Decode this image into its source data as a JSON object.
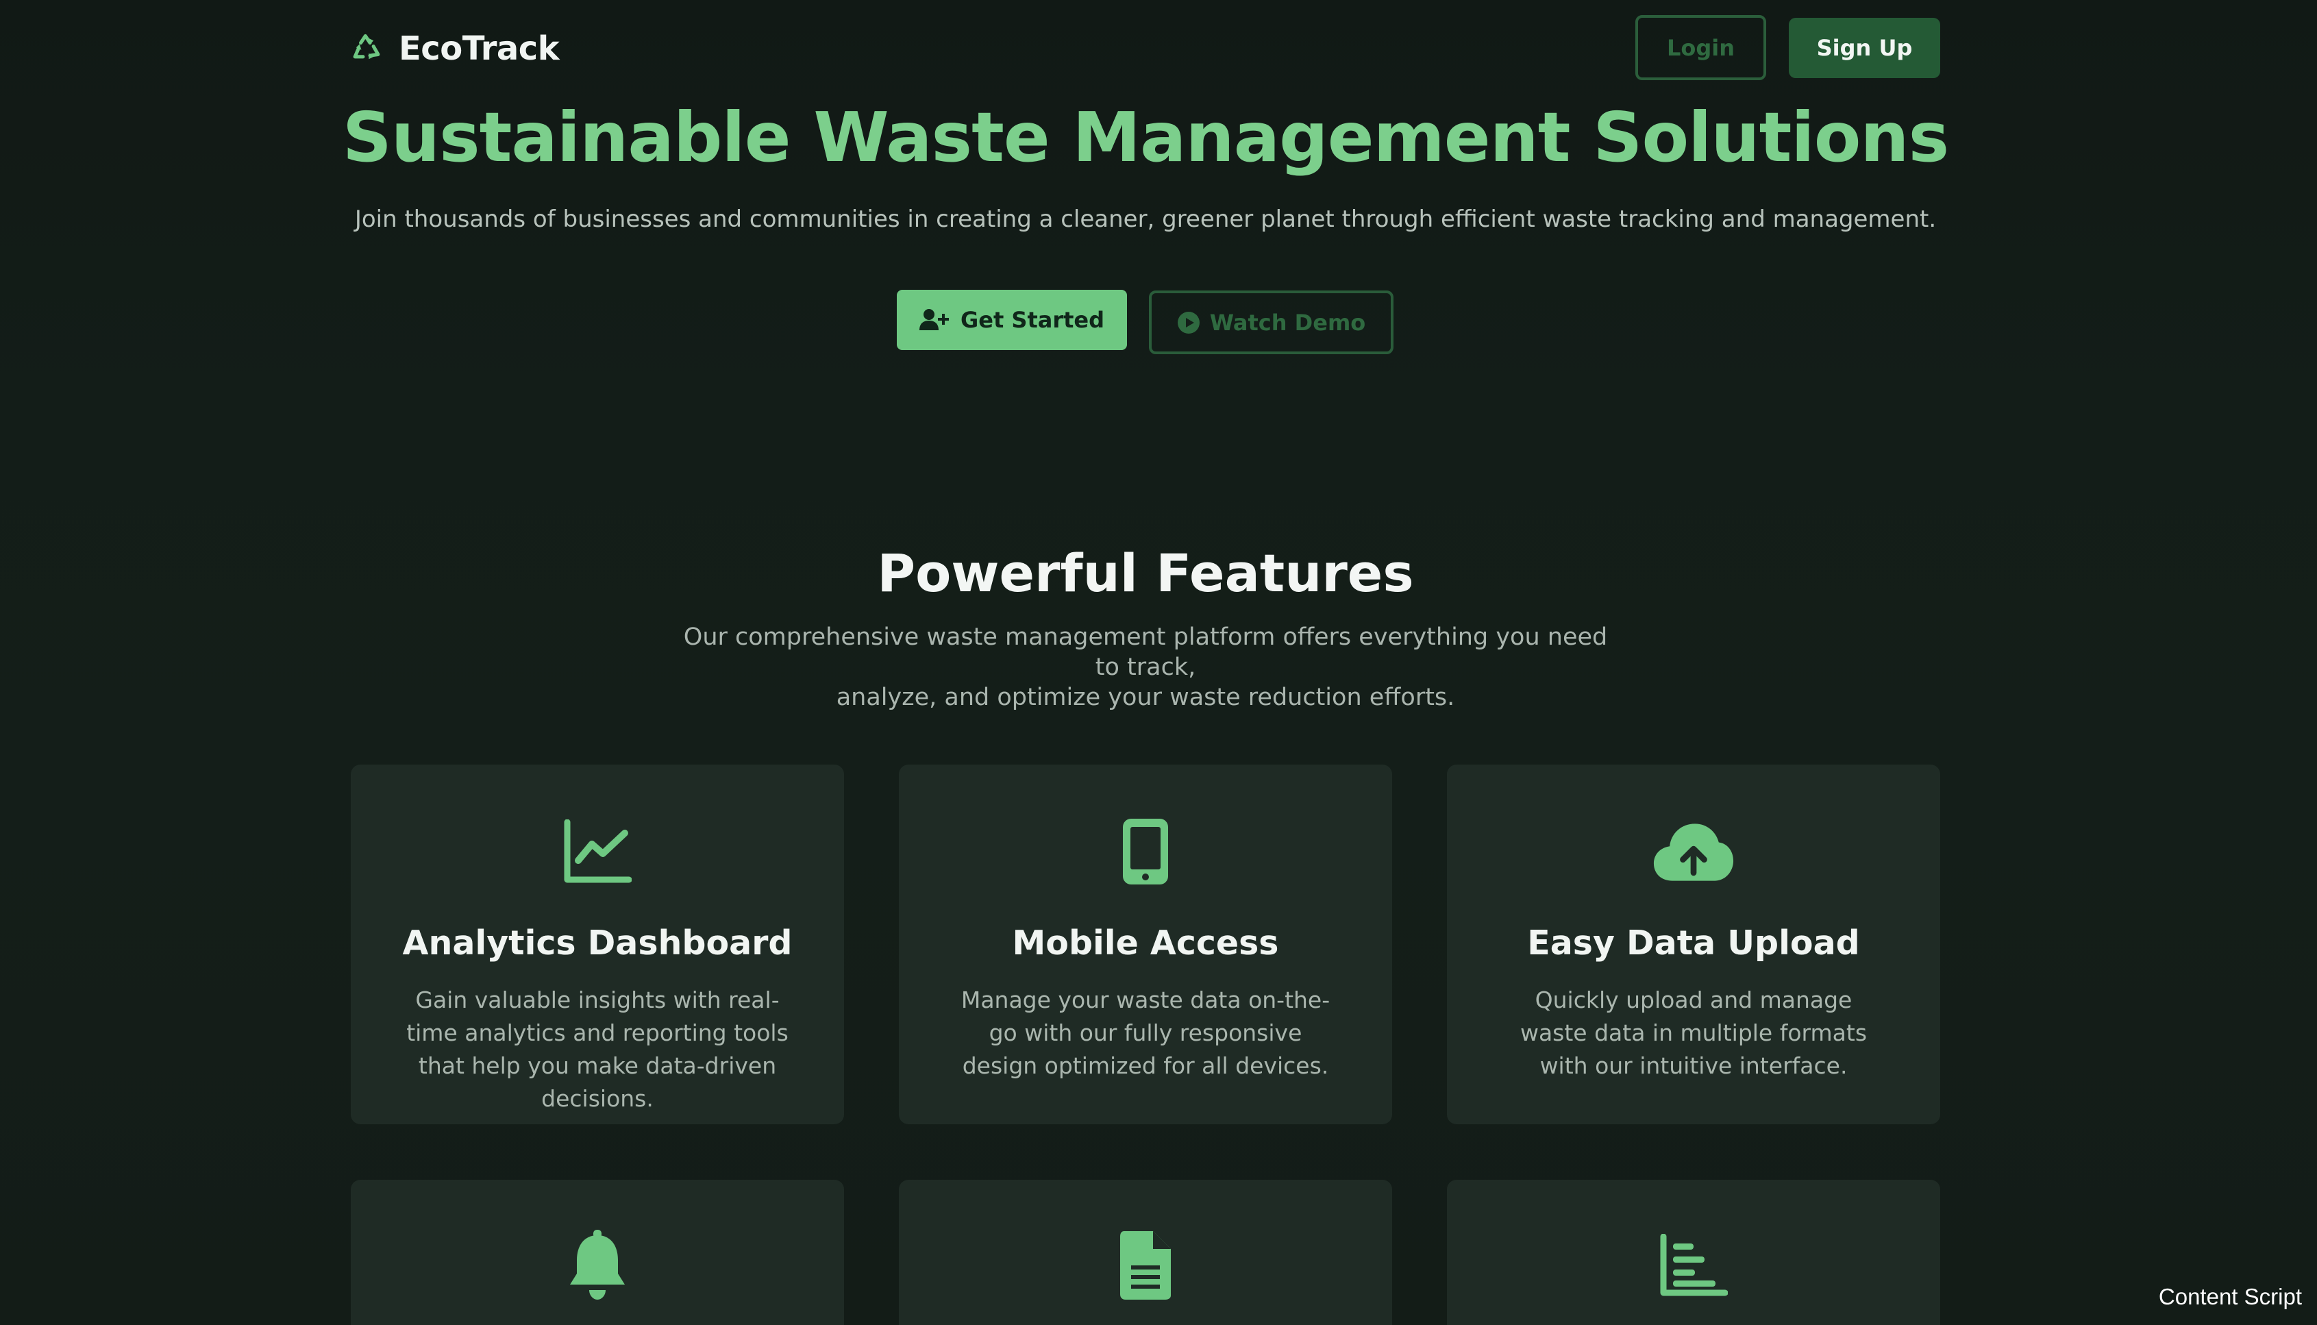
{
  "header": {
    "brand_name": "EcoTrack",
    "login_label": "Login",
    "signup_label": "Sign Up"
  },
  "hero": {
    "title": "Sustainable Waste Management Solutions",
    "subtitle": "Join thousands of businesses and communities in creating a cleaner, greener planet through efficient waste tracking and management.",
    "get_started_label": "Get Started",
    "watch_demo_label": "Watch Demo"
  },
  "features": {
    "title": "Powerful Features",
    "subtitle_line1": "Our comprehensive waste management platform offers everything you need to track,",
    "subtitle_line2": "analyze, and optimize your waste reduction efforts.",
    "cards": [
      {
        "icon": "chart-line-icon",
        "title": "Analytics Dashboard",
        "description": "Gain valuable insights with real-time analytics and reporting tools that help you make data-driven decisions."
      },
      {
        "icon": "mobile-icon",
        "title": "Mobile Access",
        "description": "Manage your waste data on-the-go with our fully responsive design optimized for all devices."
      },
      {
        "icon": "cloud-upload-icon",
        "title": "Easy Data Upload",
        "description": "Quickly upload and manage waste data in multiple formats with our intuitive interface."
      },
      {
        "icon": "bell-icon"
      },
      {
        "icon": "document-icon"
      },
      {
        "icon": "bar-chart-icon"
      }
    ]
  },
  "overlay": {
    "content_script_label": "Content Script"
  },
  "colors": {
    "background": "#121a16",
    "accent": "#6ec882",
    "accent_dark": "#245a35",
    "card": "#1f2b25"
  }
}
